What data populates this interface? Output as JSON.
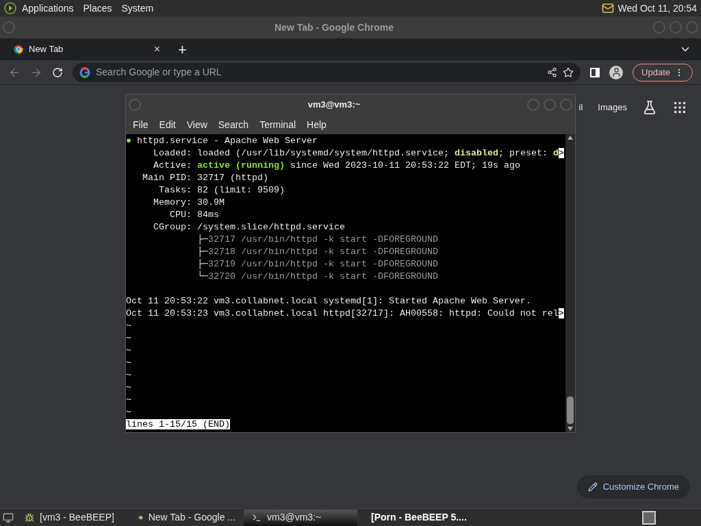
{
  "top_panel": {
    "menus": [
      "Applications",
      "Places",
      "System"
    ],
    "clock": "Wed Oct 11, 20:54"
  },
  "chrome": {
    "window_title": "New Tab - Google Chrome",
    "tabs": [
      {
        "label": "New Tab",
        "selected": true
      }
    ],
    "close_tab": "×",
    "new_tab": "+",
    "omnibox": {
      "placeholder": "Search Google or type a URL"
    },
    "update_button": "Update",
    "links": [
      "il",
      "Images"
    ],
    "customize_button": "Customize Chrome"
  },
  "terminal": {
    "title": "vm3@vm3:~",
    "menu": [
      "File",
      "Edit",
      "View",
      "Search",
      "Terminal",
      "Help"
    ],
    "lines": [
      [
        {
          "kind": "dot",
          "text": "●"
        },
        {
          "kind": "plain",
          "text": " httpd.service - Apache Web Server"
        }
      ],
      [
        {
          "kind": "plain",
          "text": "     Loaded: loaded (/usr/lib/systemd/system/httpd.service; "
        },
        {
          "kind": "warn",
          "text": "disabled"
        },
        {
          "kind": "plain",
          "text": "; preset: "
        },
        {
          "kind": "warn",
          "text": "d"
        },
        {
          "kind": "more",
          "text": ">"
        }
      ],
      [
        {
          "kind": "plain",
          "text": "     Active: "
        },
        {
          "kind": "ok",
          "text": "active (running)"
        },
        {
          "kind": "plain",
          "text": " since Wed 2023-10-11 20:53:22 EDT; 19s ago"
        }
      ],
      [
        {
          "kind": "plain",
          "text": "   Main PID: 32717 (httpd)"
        }
      ],
      [
        {
          "kind": "plain",
          "text": "      Tasks: 82 (limit: 9509)"
        }
      ],
      [
        {
          "kind": "plain",
          "text": "     Memory: 30.9M"
        }
      ],
      [
        {
          "kind": "plain",
          "text": "        CPU: 84ms"
        }
      ],
      [
        {
          "kind": "plain",
          "text": "     CGroup: /system.slice/httpd.service"
        }
      ],
      [
        {
          "kind": "plain",
          "text": "             ├─"
        },
        {
          "kind": "dim",
          "text": "32717 /usr/bin/httpd -k start -DFOREGROUND"
        }
      ],
      [
        {
          "kind": "plain",
          "text": "             ├─"
        },
        {
          "kind": "dim",
          "text": "32718 /usr/bin/httpd -k start -DFOREGROUND"
        }
      ],
      [
        {
          "kind": "plain",
          "text": "             ├─"
        },
        {
          "kind": "dim",
          "text": "32719 /usr/bin/httpd -k start -DFOREGROUND"
        }
      ],
      [
        {
          "kind": "plain",
          "text": "             └─"
        },
        {
          "kind": "dim",
          "text": "32720 /usr/bin/httpd -k start -DFOREGROUND"
        }
      ],
      {
        "kind": "blank"
      },
      [
        {
          "kind": "plain",
          "text": "Oct 11 20:53:22 vm3.collabnet.local systemd[1]: Started Apache Web Server."
        }
      ],
      [
        {
          "kind": "plain",
          "text": "Oct 11 20:53:23 vm3.collabnet.local httpd[32717]: AH00558: httpd: Could not rel"
        },
        {
          "kind": "more",
          "text": ">"
        }
      ],
      [
        {
          "kind": "plain",
          "text": "~"
        }
      ],
      [
        {
          "kind": "plain",
          "text": "~"
        }
      ],
      [
        {
          "kind": "plain",
          "text": "~"
        }
      ],
      [
        {
          "kind": "plain",
          "text": "~"
        }
      ],
      [
        {
          "kind": "plain",
          "text": "~"
        }
      ],
      [
        {
          "kind": "plain",
          "text": "~"
        }
      ],
      [
        {
          "kind": "plain",
          "text": "~"
        }
      ],
      [
        {
          "kind": "plain",
          "text": "~"
        }
      ]
    ],
    "status": "lines 1-15/15 (END)"
  },
  "taskbar": [
    {
      "label": "[vm3 - BeeBEEP]",
      "kind": "bee",
      "selected": false,
      "attention": false
    },
    {
      "label": "New Tab - Google ...",
      "kind": "chrome",
      "selected": false,
      "attention": false
    },
    {
      "label": "vm3@vm3:~",
      "kind": "terminal",
      "selected": true,
      "attention": false
    },
    {
      "label": "[Porn - BeeBEEP 5....",
      "kind": "bee",
      "selected": false,
      "attention": true
    }
  ]
}
